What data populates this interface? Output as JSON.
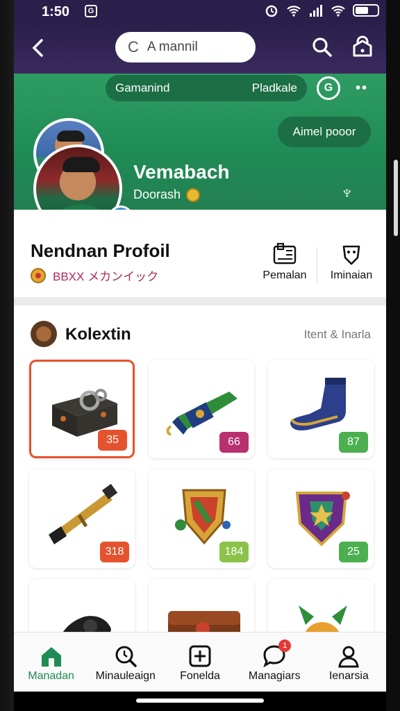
{
  "status_bar": {
    "time": "1:50",
    "notif_glyph": "G"
  },
  "topbar": {
    "search_label": "A mannil",
    "search_glyph": "C"
  },
  "header": {
    "pill_left": "Gamanind",
    "pill_right": "Pladkale",
    "circle_glyph": "G",
    "more_glyph": "••",
    "add_button": "Aimel pooor",
    "username": "Vemabach",
    "subtitle": "Doorash",
    "right_glyph": "♆"
  },
  "profile": {
    "title": "Nendnan Profoil",
    "badge_text": "BBXX メカンイック",
    "actions": [
      {
        "label": "Pemalan",
        "icon": "profile-card-icon"
      },
      {
        "label": "Iminaian",
        "icon": "shield-face-icon"
      }
    ]
  },
  "collection": {
    "title": "Kolextin",
    "link": "Itent & Inarla",
    "items": [
      {
        "name": "treasure-chest-item",
        "count": "35",
        "tag_color": "#e5532e",
        "selected": true
      },
      {
        "name": "green-cannon-item",
        "count": "66",
        "tag_color": "#b8306e",
        "selected": false
      },
      {
        "name": "blue-boot-item",
        "count": "87",
        "tag_color": "#4caf50",
        "selected": false
      },
      {
        "name": "telescope-item",
        "count": "318",
        "tag_color": "#e5532e",
        "selected": false
      },
      {
        "name": "gold-shield-item",
        "count": "184",
        "tag_color": "#8bc34a",
        "selected": false
      },
      {
        "name": "purple-shield-item",
        "count": "25",
        "tag_color": "#4caf50",
        "selected": false
      }
    ]
  },
  "nav": {
    "items": [
      {
        "label": "Manadan",
        "icon": "home-icon",
        "active": true
      },
      {
        "label": "Minauleaign",
        "icon": "search-icon",
        "active": false
      },
      {
        "label": "Fonelda",
        "icon": "plus-box-icon",
        "active": false
      },
      {
        "label": "Managiars",
        "icon": "chat-icon",
        "active": false,
        "badge": "1"
      },
      {
        "label": "Ienarsia",
        "icon": "person-icon",
        "active": false
      }
    ]
  }
}
